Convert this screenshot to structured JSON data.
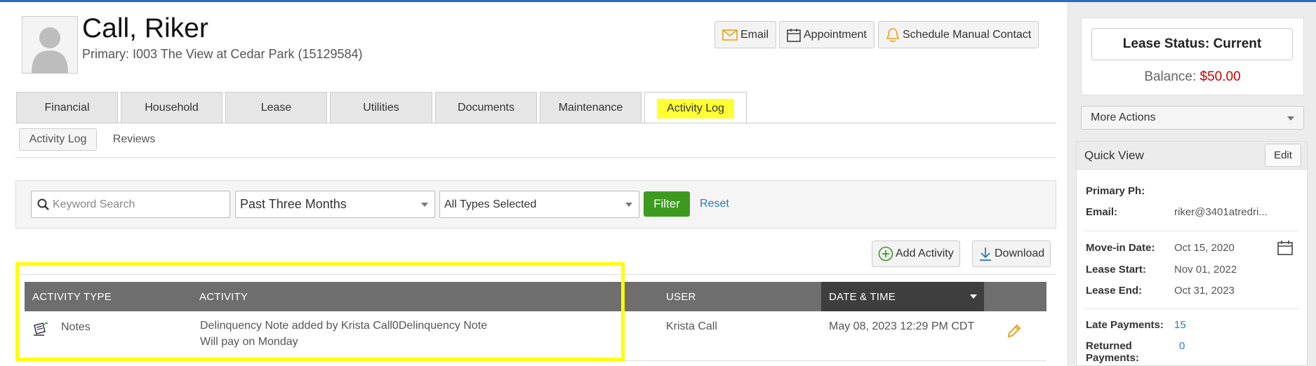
{
  "header": {
    "tenant_name": "Call, Riker",
    "primary_unit": "Primary: I003 The View at Cedar Park (15129584)"
  },
  "header_buttons": {
    "email": "Email",
    "appointment": "Appointment",
    "schedule": "Schedule Manual Contact"
  },
  "tabs": [
    {
      "label": "Financial"
    },
    {
      "label": "Household"
    },
    {
      "label": "Lease"
    },
    {
      "label": "Utilities"
    },
    {
      "label": "Documents"
    },
    {
      "label": "Maintenance"
    },
    {
      "label": "Activity Log"
    }
  ],
  "subtabs": [
    {
      "label": "Activity Log"
    },
    {
      "label": "Reviews"
    }
  ],
  "filters": {
    "search_placeholder": "Keyword Search",
    "period": "Past Three Months",
    "types": "All Types Selected",
    "filter_label": "Filter",
    "reset_label": "Reset"
  },
  "actions": {
    "add_activity": "Add Activity",
    "download": "Download"
  },
  "table": {
    "columns": [
      "ACTIVITY TYPE",
      "ACTIVITY",
      "USER",
      "DATE & TIME"
    ],
    "rows": [
      {
        "type": "Notes",
        "activity_line1": "Delinquency Note added by Krista Call0Delinquency Note",
        "activity_line2": "Will pay on Monday",
        "user": "Krista Call",
        "datetime": "May 08, 2023 12:29 PM CDT"
      }
    ]
  },
  "side": {
    "lease_status": "Lease Status: Current",
    "balance_label": "Balance:",
    "balance_amount": "$50.00",
    "more_actions": "More Actions",
    "quick_view_title": "Quick View",
    "edit_label": "Edit",
    "fields": {
      "primary_ph_label": "Primary Ph:",
      "email_label": "Email:",
      "email_value": "riker@3401atredri...",
      "move_in_label": "Move-in Date:",
      "move_in_value": "Oct 15, 2020",
      "lease_start_label": "Lease Start:",
      "lease_start_value": "Nov 01, 2022",
      "lease_end_label": "Lease End:",
      "lease_end_value": "Oct 31, 2023",
      "late_payments_label": "Late Payments:",
      "late_payments_value": "15",
      "returned_payments_label": "Returned Payments:",
      "returned_payments_value": "0"
    }
  },
  "colors": {
    "accent_green": "#3c9a1f",
    "highlight_yellow": "#ffff00",
    "link_blue": "#2a7ac6",
    "balance_red": "#cc0000",
    "table_header": "#6e6e6e"
  }
}
